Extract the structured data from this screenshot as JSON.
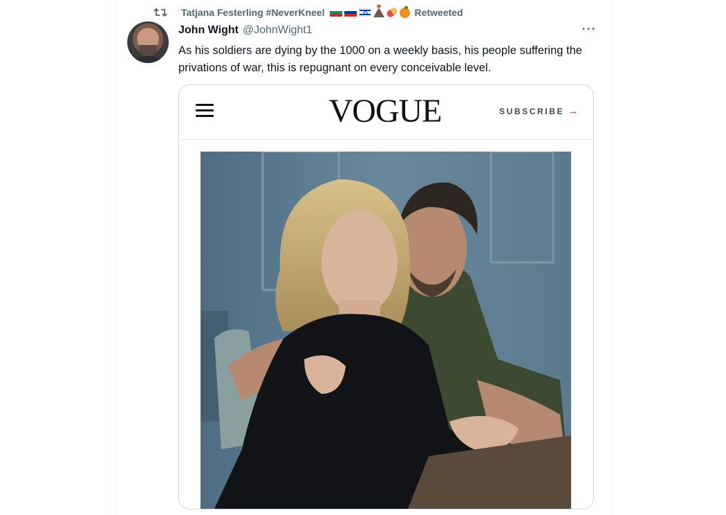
{
  "retweet": {
    "user": "Tatjana Festerling #NeverKneel",
    "label": "Retweeted"
  },
  "tweet": {
    "author_name": "John Wight",
    "author_handle": "@JohnWight1",
    "text": "As his soldiers are dying by the 1000 on a weekly basis, his people suffering the privations of war, this is repugnant on every conceivable level.",
    "more_label": "···"
  },
  "card": {
    "brand": "VOGUE",
    "subscribe_label": "SUBSCRIBE",
    "subscribe_arrow": "→"
  },
  "icons": {
    "retweet": "retweet-icon",
    "menu": "hamburger-menu-icon",
    "more": "more-options-icon"
  },
  "colors": {
    "secondary_text": "#536471",
    "primary_text": "#0f1419",
    "card_border": "#cfd9de"
  }
}
